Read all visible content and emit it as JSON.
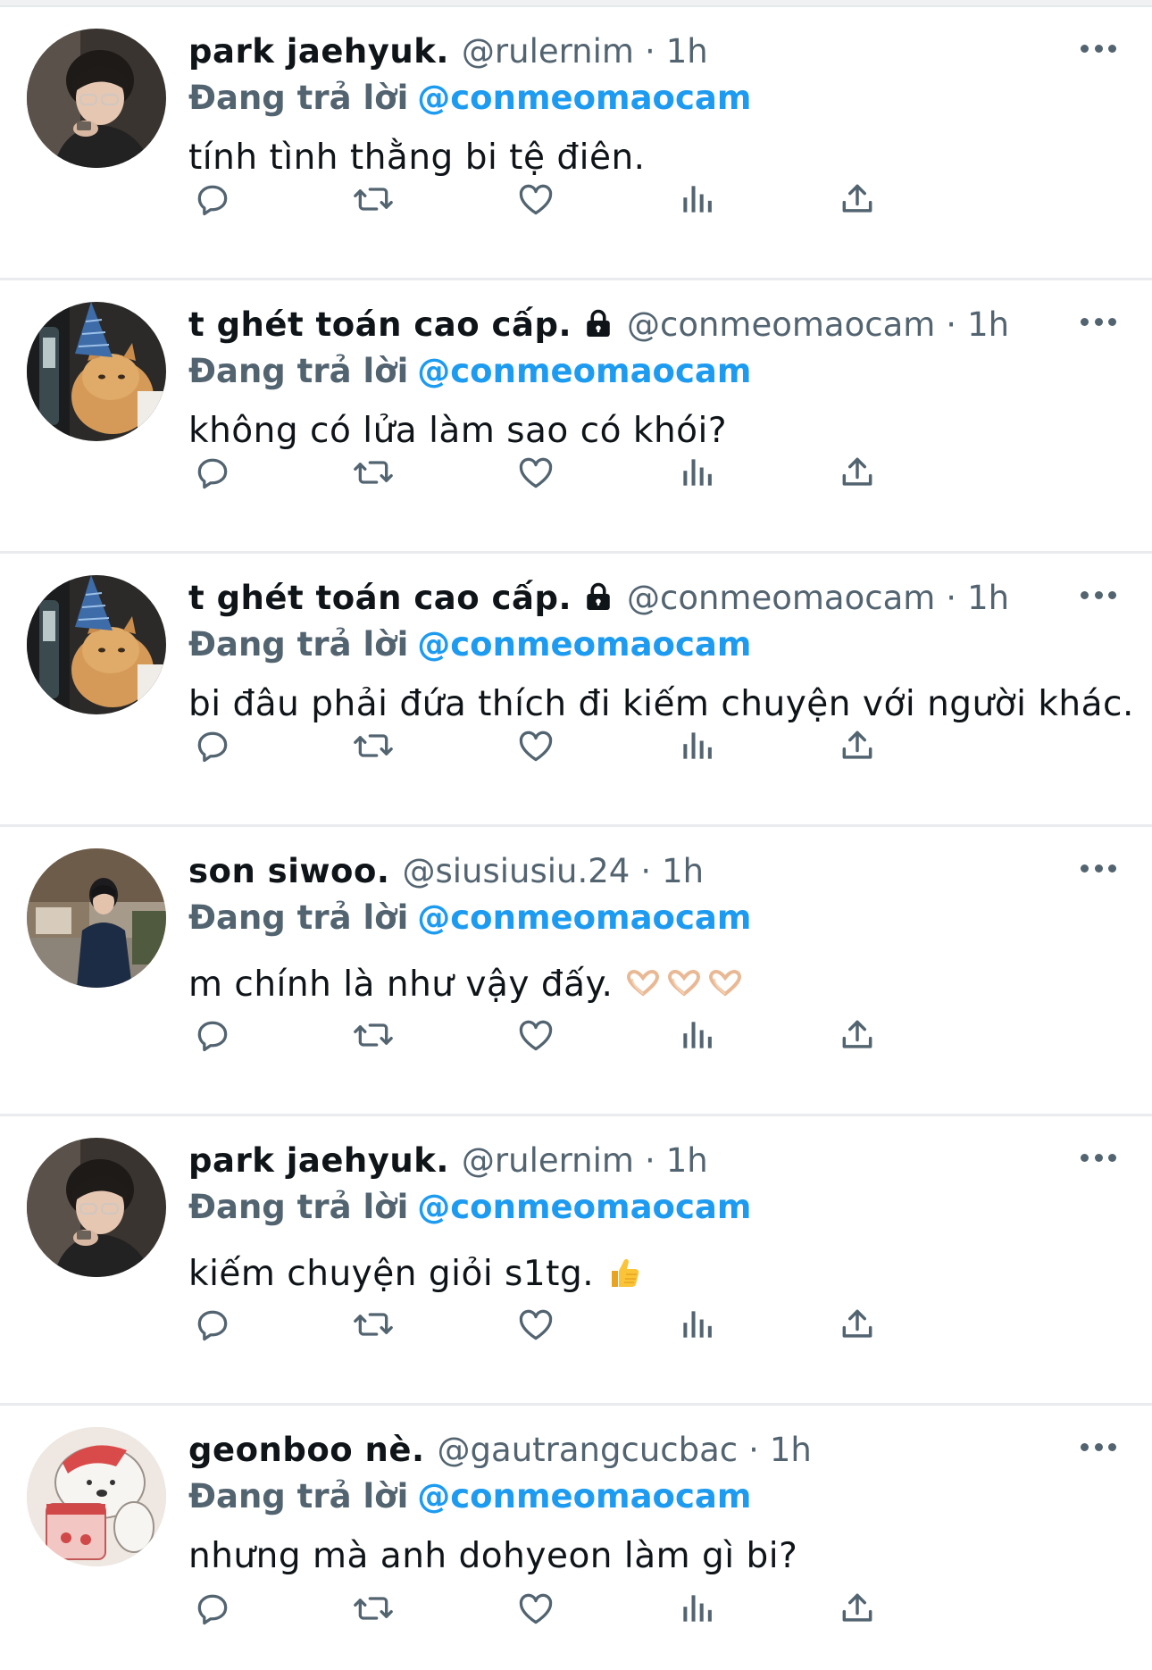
{
  "reply_prefix": "Đang trả lời",
  "colors": {
    "name": "#0f1419",
    "secondary": "#536471",
    "link": "#1d9bf0",
    "divider": "#e9ebee"
  },
  "action_icons": [
    "reply-icon",
    "retweet-icon",
    "like-icon",
    "views-icon",
    "share-icon"
  ],
  "tweets": [
    {
      "name": "park jaehyuk.",
      "handle": "@rulernim",
      "dot": "·",
      "time": "1h",
      "reply_to": "@conmeomaocam",
      "text": "tính tình thằng bi tệ điên.",
      "locked": false,
      "avatar": "boy-glasses-photo"
    },
    {
      "name": "t ghét toán cao cấp.",
      "handle": "@conmeomaocam",
      "dot": "·",
      "time": "1h",
      "reply_to": "@conmeomaocam",
      "text": "không có lửa làm sao có khói?",
      "locked": true,
      "avatar": "cat-party-hat-photo"
    },
    {
      "name": "t ghét toán cao cấp.",
      "handle": "@conmeomaocam",
      "dot": "·",
      "time": "1h",
      "reply_to": "@conmeomaocam",
      "text": "bi đâu phải đứa thích đi kiếm chuyện với người khác.",
      "locked": true,
      "avatar": "cat-party-hat-photo"
    },
    {
      "name": "son siwoo.",
      "handle": "@siusiusiu.24",
      "dot": "·",
      "time": "1h",
      "reply_to": "@conmeomaocam",
      "text": "m chính là như vậy đấy.",
      "emoji": "heart-hands",
      "locked": false,
      "avatar": "boy-street-photo"
    },
    {
      "name": "park jaehyuk.",
      "handle": "@rulernim",
      "dot": "·",
      "time": "1h",
      "reply_to": "@conmeomaocam",
      "text": "kiếm chuyện giỏi s1tg.",
      "emoji": "thumbs-up",
      "locked": false,
      "avatar": "boy-glasses-photo"
    },
    {
      "name": "geonboo nè.",
      "handle": "@gautrangcucbac",
      "dot": "·",
      "time": "1h",
      "reply_to": "@conmeomaocam",
      "text": "nhưng mà anh dohyeon làm gì bi?",
      "locked": false,
      "avatar": "polar-bear-cartoon"
    }
  ]
}
